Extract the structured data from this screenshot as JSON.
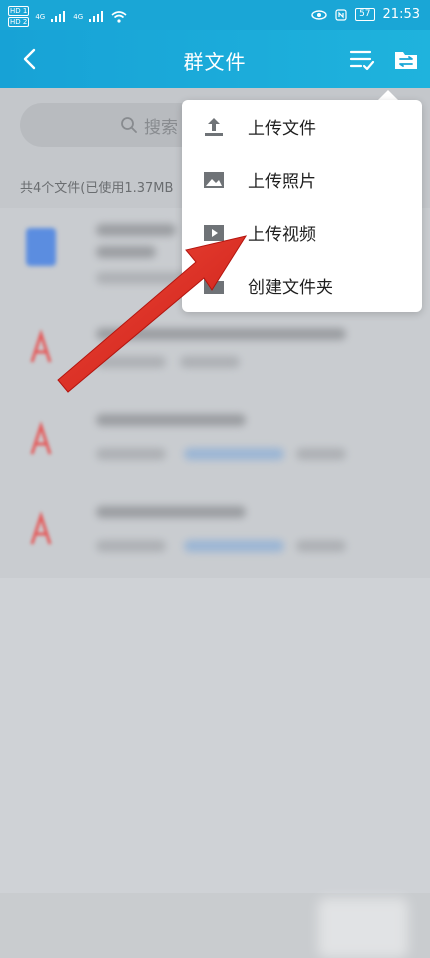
{
  "status_bar": {
    "time": "21:53",
    "battery": "57",
    "network_left": "4G",
    "network_right": "4G"
  },
  "header": {
    "title": "群文件"
  },
  "search": {
    "placeholder": "搜索"
  },
  "summary": {
    "text": "共4个文件(已使用1.37MB"
  },
  "menu": {
    "items": [
      {
        "label": "上传文件",
        "icon": "upload-icon"
      },
      {
        "label": "上传照片",
        "icon": "image-icon"
      },
      {
        "label": "上传视频",
        "icon": "video-icon"
      },
      {
        "label": "创建文件夹",
        "icon": "folder-icon"
      }
    ]
  },
  "colors": {
    "accent": "#1aa6d6",
    "arrow": "#e0241c",
    "pdf": "#e45a5a",
    "doc": "#5b8de0"
  }
}
